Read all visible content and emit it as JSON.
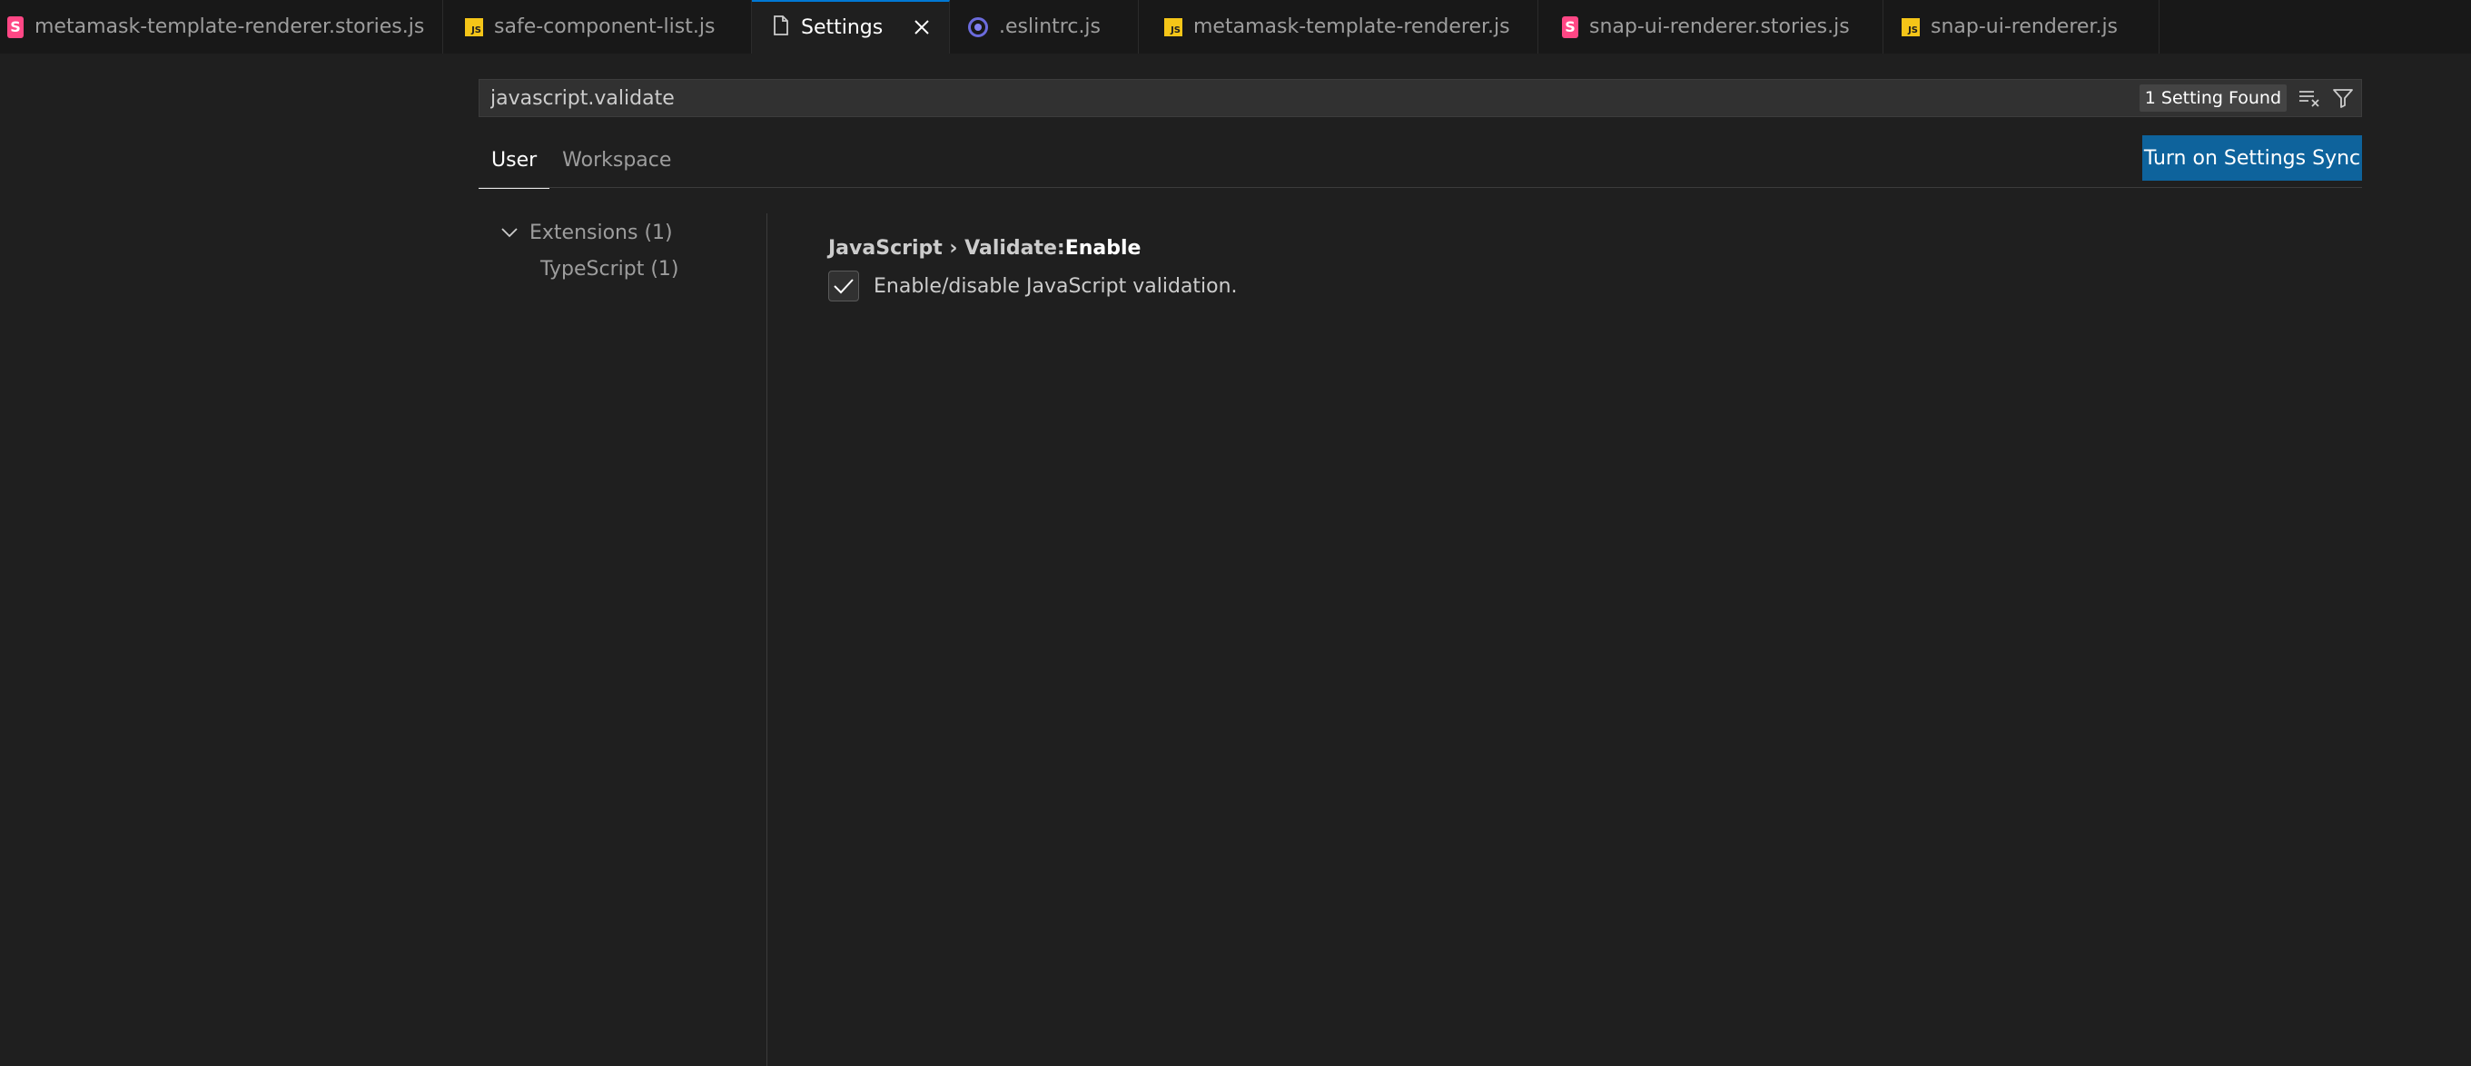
{
  "tabs": [
    {
      "label": "metamask-template-renderer.stories.js",
      "icon": "storybook-icon",
      "active": false
    },
    {
      "label": "safe-component-list.js",
      "icon": "js-file-icon",
      "active": false
    },
    {
      "label": "Settings",
      "icon": "settings-file-icon",
      "active": true
    },
    {
      "label": ".eslintrc.js",
      "icon": "eslint-icon",
      "active": false
    },
    {
      "label": "metamask-template-renderer.js",
      "icon": "js-file-icon",
      "active": false
    },
    {
      "label": "snap-ui-renderer.stories.js",
      "icon": "storybook-icon",
      "active": false
    },
    {
      "label": "snap-ui-renderer.js",
      "icon": "js-file-icon",
      "active": false
    }
  ],
  "icon_glyphs": {
    "storybook": "S",
    "js": "JS"
  },
  "search": {
    "value": "javascript.validate",
    "result_count": "1 Setting Found"
  },
  "scope_tabs": [
    {
      "label": "User",
      "active": true
    },
    {
      "label": "Workspace",
      "active": false
    }
  ],
  "sync_button": "Turn on Settings Sync",
  "toc": {
    "group": "Extensions (1)",
    "child": "TypeScript (1)"
  },
  "setting": {
    "category": "JavaScript › Validate: ",
    "name": "Enable",
    "checked": true,
    "description": "Enable/disable JavaScript validation."
  },
  "colors": {
    "accent": "#0078d4",
    "sync_button_bg": "#0e639c",
    "storybook": "#ff4785",
    "js": "#f5c518",
    "eslint": "#6b6bdc"
  }
}
